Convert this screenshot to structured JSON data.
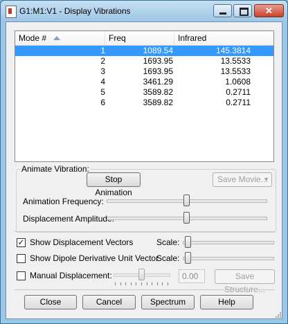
{
  "window": {
    "title": "G1:M1:V1 - Display Vibrations"
  },
  "titlebar": {
    "close_glyph": "✕"
  },
  "vibrations_table": {
    "headers": [
      "Mode #",
      "Freq",
      "Infrared"
    ],
    "rows": [
      {
        "mode": "1",
        "freq": "1089.54",
        "infrared": "145.3814",
        "selected": true
      },
      {
        "mode": "2",
        "freq": "1693.95",
        "infrared": "13.5533",
        "selected": false
      },
      {
        "mode": "3",
        "freq": "1693.95",
        "infrared": "13.5533",
        "selected": false
      },
      {
        "mode": "4",
        "freq": "3461.29",
        "infrared": "1.0608",
        "selected": false
      },
      {
        "mode": "5",
        "freq": "3589.82",
        "infrared": "0.2711",
        "selected": false
      },
      {
        "mode": "6",
        "freq": "3589.82",
        "infrared": "0.2711",
        "selected": false
      }
    ]
  },
  "animate": {
    "group_label": "Animate Vibration:",
    "stop_animation_label": "Stop Animation",
    "save_movie_label": "Save Movie...",
    "frequency_label": "Animation Frequency:",
    "frequency_level": 0.5,
    "amplitude_label": "Displacement Amplitude:",
    "amplitude_level": 0.5
  },
  "options": {
    "show_displacement_vectors": {
      "label": "Show Displacement Vectors",
      "checked": true,
      "scale_label": "Scale:",
      "scale_level": 0.05
    },
    "show_dipole_vector": {
      "label": "Show Dipole Derivative Unit Vector",
      "checked": false,
      "scale_label": "Scale:",
      "scale_level": 0.05
    },
    "manual_displacement": {
      "label": "Manual Displacement:",
      "checked": false,
      "value": "0.00",
      "slider_level": 0.5
    },
    "save_structure_label": "Save Structure..."
  },
  "footer": {
    "close_label": "Close",
    "cancel_label": "Cancel",
    "spectrum_label": "Spectrum",
    "help_label": "Help"
  }
}
